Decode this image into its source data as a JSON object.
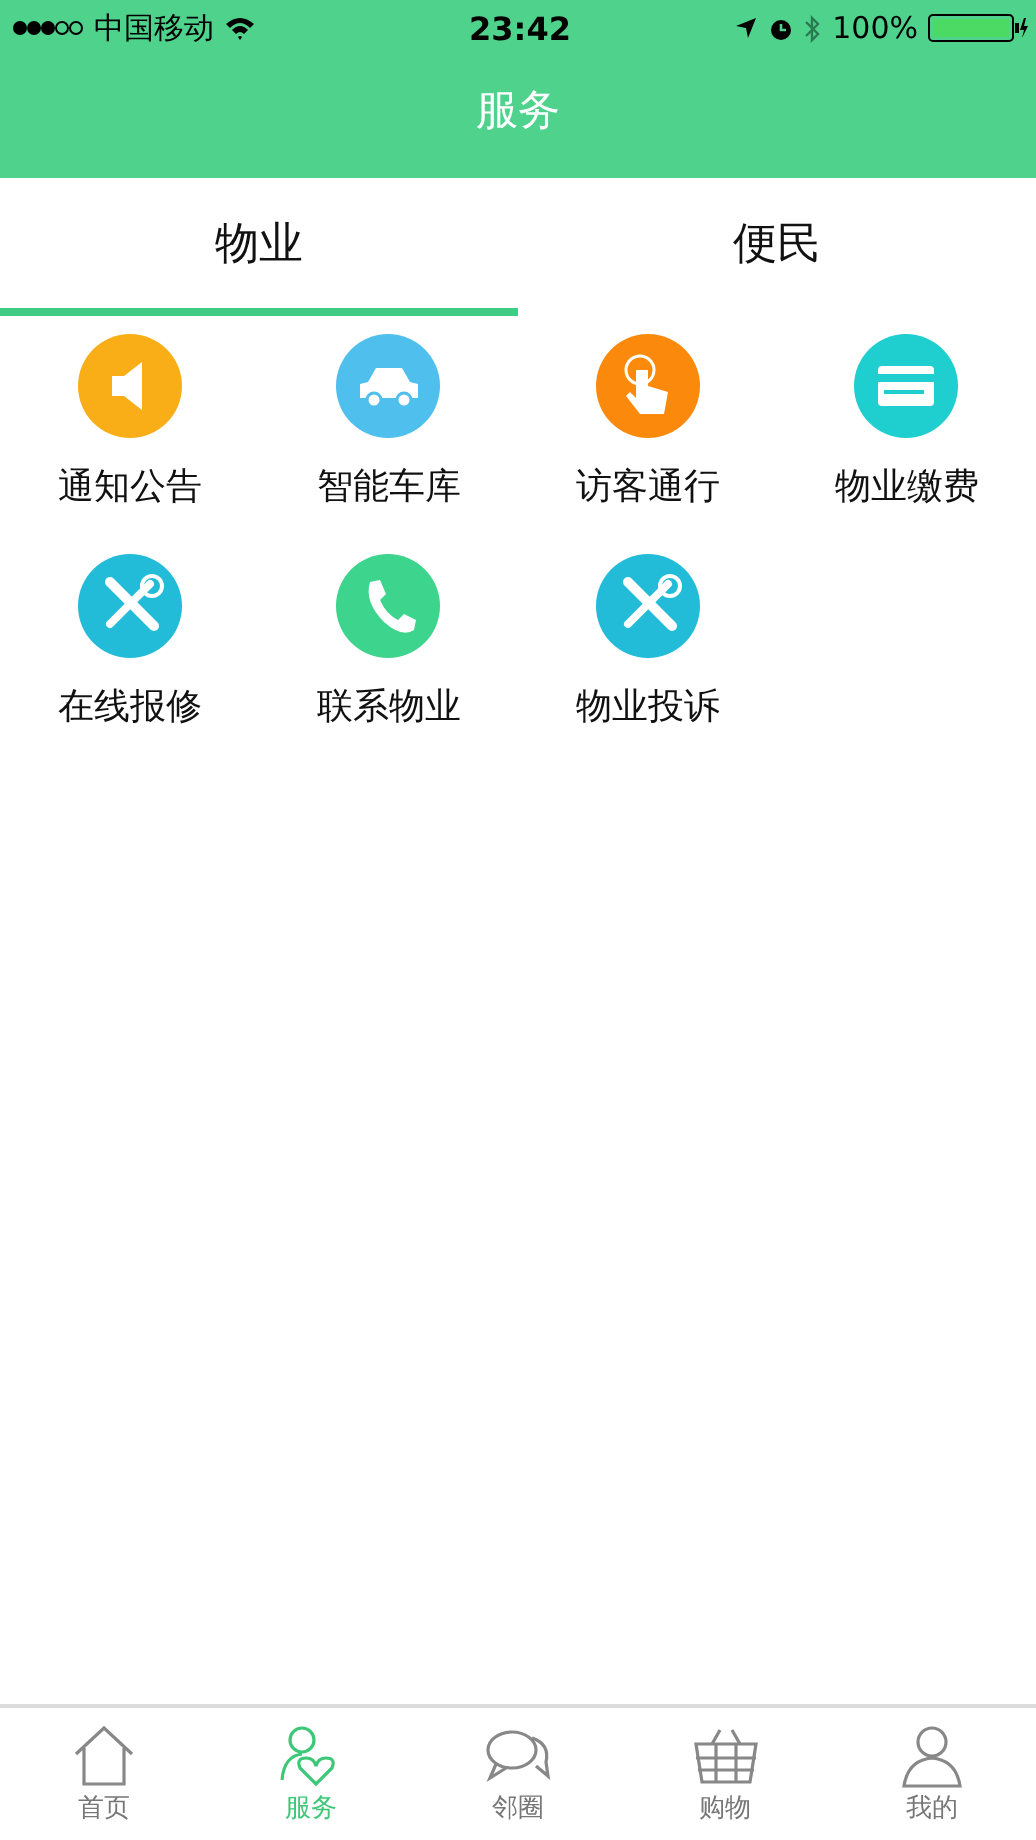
{
  "status_bar": {
    "carrier": "中国移动",
    "time": "23:42",
    "battery": "100%"
  },
  "header": {
    "title": "服务"
  },
  "tabs": [
    {
      "label": "物业",
      "selected": true
    },
    {
      "label": "便民",
      "selected": false
    }
  ],
  "services": [
    {
      "label": "通知公告",
      "kind": "speaker",
      "color": "#f9ae17"
    },
    {
      "label": "智能车库",
      "kind": "car",
      "color": "#4fbfee"
    },
    {
      "label": "访客通行",
      "kind": "touch",
      "color": "#fb8a0c"
    },
    {
      "label": "物业缴费",
      "kind": "card",
      "color": "#1fcfd0"
    },
    {
      "label": "在线报修",
      "kind": "tools",
      "color": "#22bcd8"
    },
    {
      "label": "联系物业",
      "kind": "phone",
      "color": "#3dd48e"
    },
    {
      "label": "物业投诉",
      "kind": "tools",
      "color": "#22bcd8"
    }
  ],
  "bottom_nav": [
    {
      "label": "首页",
      "kind": "home",
      "selected": false
    },
    {
      "label": "服务",
      "kind": "service",
      "selected": true
    },
    {
      "label": "邻圈",
      "kind": "chat",
      "selected": false
    },
    {
      "label": "购物",
      "kind": "basket",
      "selected": false
    },
    {
      "label": "我的",
      "kind": "person",
      "selected": false
    }
  ]
}
